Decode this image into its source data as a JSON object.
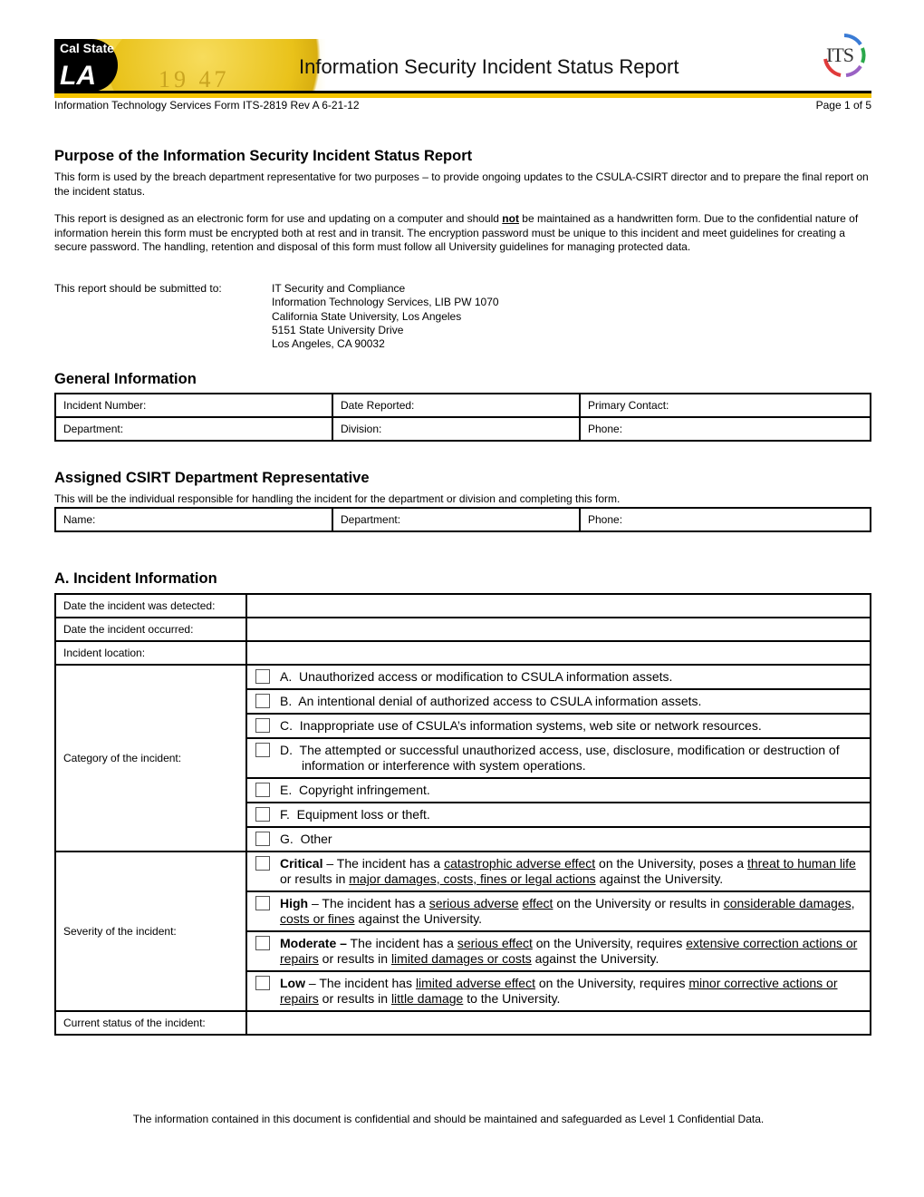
{
  "header": {
    "logo_text_top": "Cal State",
    "logo_text_bottom": "LA",
    "seal_text": "19 47",
    "title": "Information Security Incident Status Report",
    "its_logo": "ITS",
    "form_id": "Information Technology Services Form ITS-2819 Rev A  6-21-12",
    "page_label": "Page 1 of 5"
  },
  "purpose": {
    "heading": "Purpose of the Information Security Incident Status Report",
    "para1": "This form is used by the breach department representative for two purposes – to provide ongoing updates to the CSULA-CSIRT director and to prepare the final report on the incident status.",
    "para2_before": "This report is designed as an electronic form for use and updating on a computer and should ",
    "para2_emphasis": "not",
    "para2_after": " be maintained as a handwritten form.  Due to the confidential nature of information herein this form must be encrypted both at rest and in transit.  The encryption password must be unique to this incident and meet guidelines for creating a secure password.  The handling, retention and disposal of this form must follow all University guidelines for managing protected data.",
    "submit_label": "This report should be submitted to:",
    "address": [
      "IT Security and Compliance",
      "Information Technology Services, LIB PW 1070",
      "California State University, Los Angeles",
      "5151 State University Drive",
      "Los Angeles, CA 90032"
    ]
  },
  "general": {
    "heading": "General Information",
    "rows": [
      [
        "Incident Number:",
        "Date Reported:",
        "Primary Contact:"
      ],
      [
        "Department:",
        "Division:",
        "Phone:"
      ]
    ]
  },
  "csirt": {
    "heading": "Assigned CSIRT Department Representative",
    "description": "This will be the individual responsible for handling the incident for the department or division and completing this form.",
    "row": [
      "Name:",
      "Department:",
      "Phone:"
    ]
  },
  "incident": {
    "heading": "A. Incident Information",
    "date_detected_label": "Date the incident was detected:",
    "date_occurred_label": "Date the incident occurred:",
    "location_label": "Incident location:",
    "category_label": "Category of the incident:",
    "categories": [
      {
        "letter": "A.",
        "text": "Unauthorized access or modification to CSULA information assets.",
        "checked": false
      },
      {
        "letter": "B.",
        "text": "An intentional denial of authorized access to CSULA information assets.",
        "checked": false
      },
      {
        "letter": "C.",
        "text": "Inappropriate use of CSULA’s information systems, web site or network resources.",
        "checked": false
      },
      {
        "letter": "D.",
        "text": "The attempted or successful unauthorized access, use, disclosure, modification or destruction of information or interference with system operations.",
        "checked": false
      },
      {
        "letter": "E.",
        "text": "Copyright infringement.",
        "checked": false
      },
      {
        "letter": "F.",
        "text": "Equipment loss or theft.",
        "checked": false
      },
      {
        "letter": "G.",
        "text": "Other",
        "checked": false
      }
    ],
    "severity_label": "Severity of the incident:",
    "severity": {
      "critical": {
        "name": "Critical",
        "t1": " – The incident has a ",
        "u1": "catastrophic adverse effect",
        "t2": " on the University, poses a ",
        "u2": "threat to human life",
        "t3": " or results in ",
        "u3": "major damages, costs, fines or legal actions",
        "t4": " against the University."
      },
      "high": {
        "name": "High",
        "t1": " – The incident has a ",
        "u1": "serious adverse",
        "t2": " ",
        "u2": "effect",
        "t3": " on the University or results in ",
        "u3": "considerable damages, costs or fines",
        "t4": " against the University."
      },
      "moderate": {
        "name": "Moderate –",
        "t1": " The incident has a ",
        "u1": "serious effect",
        "t2": " on the University, requires ",
        "u2": "extensive correction actions or repairs",
        "t3": " or results in ",
        "u3": "limited damages or costs",
        "t4": " against the University."
      },
      "low": {
        "name": "Low",
        "t1": " – The incident has ",
        "u1": "limited adverse effect",
        "t2": " on the University, requires ",
        "u2": "minor corrective actions or repairs",
        "t3": " or results in ",
        "u3": "little damage",
        "t4": " to the University."
      }
    },
    "status_label": "Current status of the incident:"
  },
  "footer": "The information contained in this document is confidential and should be maintained and safeguarded as Level 1 Confidential Data."
}
